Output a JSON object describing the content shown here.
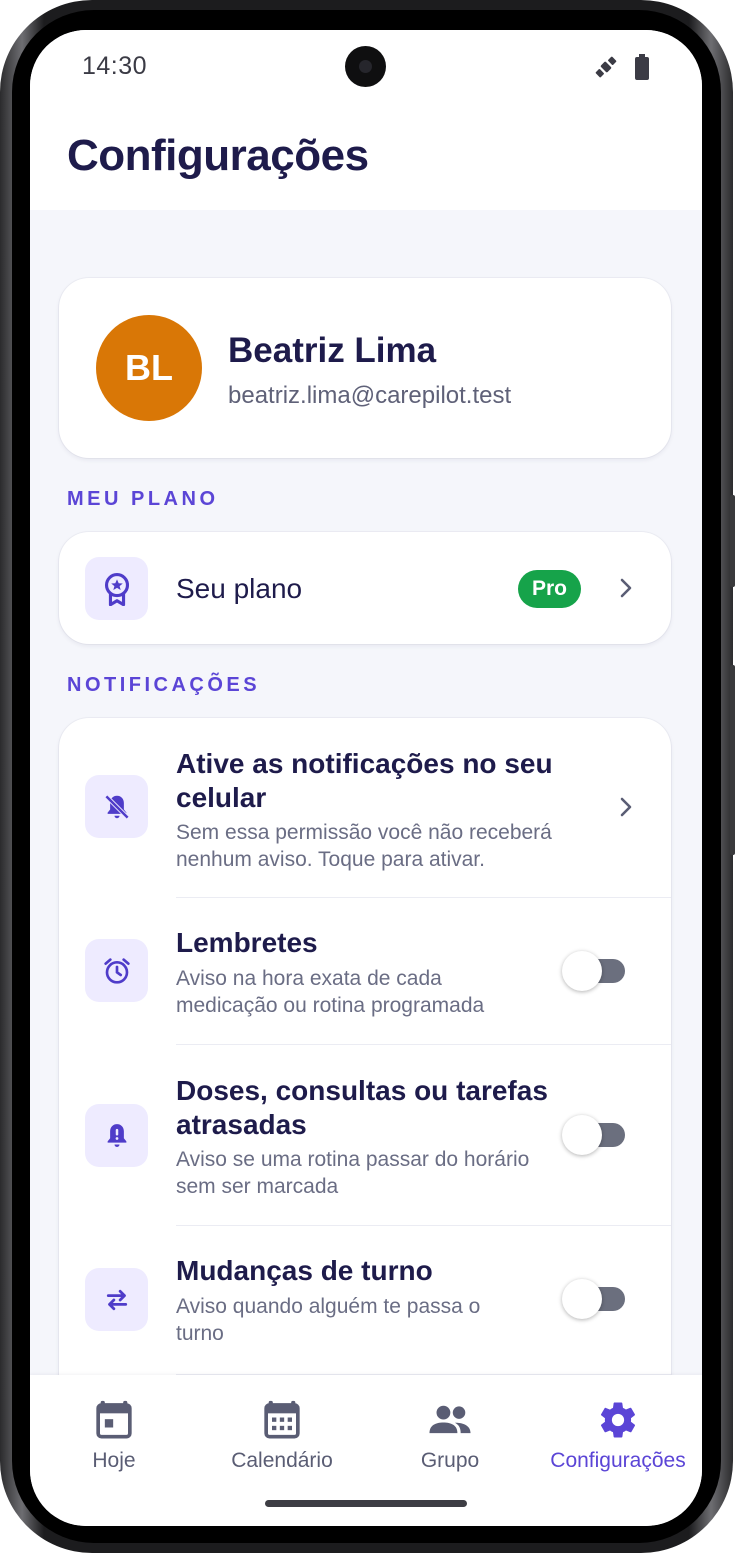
{
  "status": {
    "time": "14:30"
  },
  "header": {
    "title": "Configurações"
  },
  "profile": {
    "initials": "BL",
    "name": "Beatriz Lima",
    "email": "beatriz.lima@carepilot.test",
    "avatar_color": "#d97706"
  },
  "plan_section": {
    "label": "MEU PLANO",
    "row": {
      "title": "Seu plano",
      "badge": "Pro",
      "badge_color": "#16a34a",
      "icon": "award-icon"
    }
  },
  "notifications_section": {
    "label": "NOTIFICAÇÕES",
    "rows": [
      {
        "title": "Ative as notificações no seu celular",
        "subtitle": "Sem essa permissão você não receberá nenhum aviso. Toque para ativar.",
        "icon": "bell-off-icon",
        "control": "chevron"
      },
      {
        "title": "Lembretes",
        "subtitle": "Aviso na hora exata de cada medicação ou rotina programada",
        "icon": "alarm-clock-icon",
        "control": "toggle",
        "enabled": false
      },
      {
        "title": "Doses, consultas ou tarefas atrasadas",
        "subtitle": "Aviso se uma rotina passar do horário sem ser marcada",
        "icon": "bell-alert-icon",
        "control": "toggle",
        "enabled": false
      },
      {
        "title": "Mudanças de turno",
        "subtitle": "Aviso quando alguém te passa o turno",
        "icon": "swap-arrows-icon",
        "control": "toggle",
        "enabled": false
      }
    ]
  },
  "bottom_nav": {
    "items": [
      {
        "label": "Hoje",
        "icon": "calendar-today-icon",
        "active": false
      },
      {
        "label": "Calendário",
        "icon": "calendar-month-icon",
        "active": false
      },
      {
        "label": "Grupo",
        "icon": "group-icon",
        "active": false
      },
      {
        "label": "Configurações",
        "icon": "gear-icon",
        "active": true
      }
    ]
  },
  "colors": {
    "accent": "#5b45d6",
    "title": "#1e1b4b",
    "background": "#f5f6fb"
  }
}
